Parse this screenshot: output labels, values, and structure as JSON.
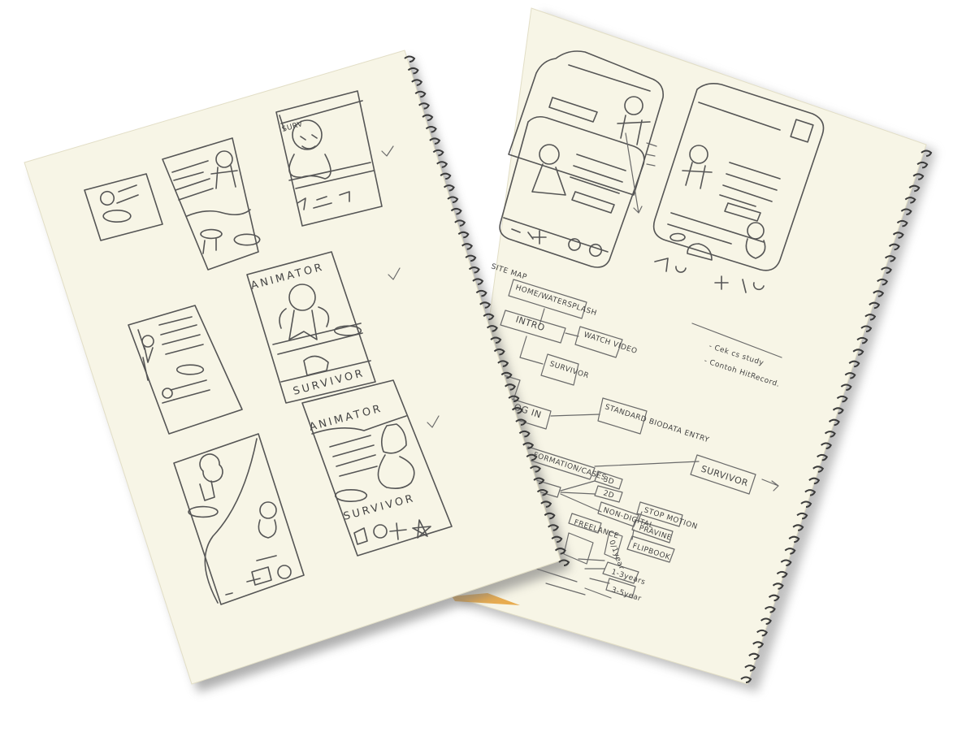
{
  "colors": {
    "paper": "#f7f5e6",
    "paper_edge": "#e8e4cc",
    "pencil": "#555555",
    "spiral": "#3a3a3a",
    "shadow": "#9a9a9a",
    "orange_edge": "#e39a2a"
  },
  "left_sheet": {
    "animator_label_1": "ANIMATOR",
    "animator_label_2": "ANIMATOR",
    "survivor_label_1": "SURVIVOR",
    "survivor_label_2": "SURVIVOR",
    "survivor_label_small": "SURV"
  },
  "right_sheet": {
    "sitemap_title": "SITE MAP",
    "nodes": {
      "home": "HOME/WATERSPLASH",
      "intro": "INTRO",
      "watch_video": "WATCH VIDEO",
      "survivor_small": "SURVIVOR",
      "login": "LOG IN",
      "biodata": "STANDARD BIODATA ENTRY",
      "formation": "FORMATION/CASES",
      "survivor_big": "SURVIVOR",
      "n3d": "3D",
      "n2d": "2D",
      "non_digital": "NON-DIGITAL",
      "stop_motion": "STOP MOTION",
      "pravine": "PRAVINE",
      "flipbook": "FLIPBOOK",
      "freelance": "FREELANCE",
      "year_0_1": "0/1year",
      "year_1_3": "1-3years",
      "year_3": "3-5year"
    },
    "notes": [
      "- Cek cs study",
      "- Contoh HitRecord."
    ]
  }
}
